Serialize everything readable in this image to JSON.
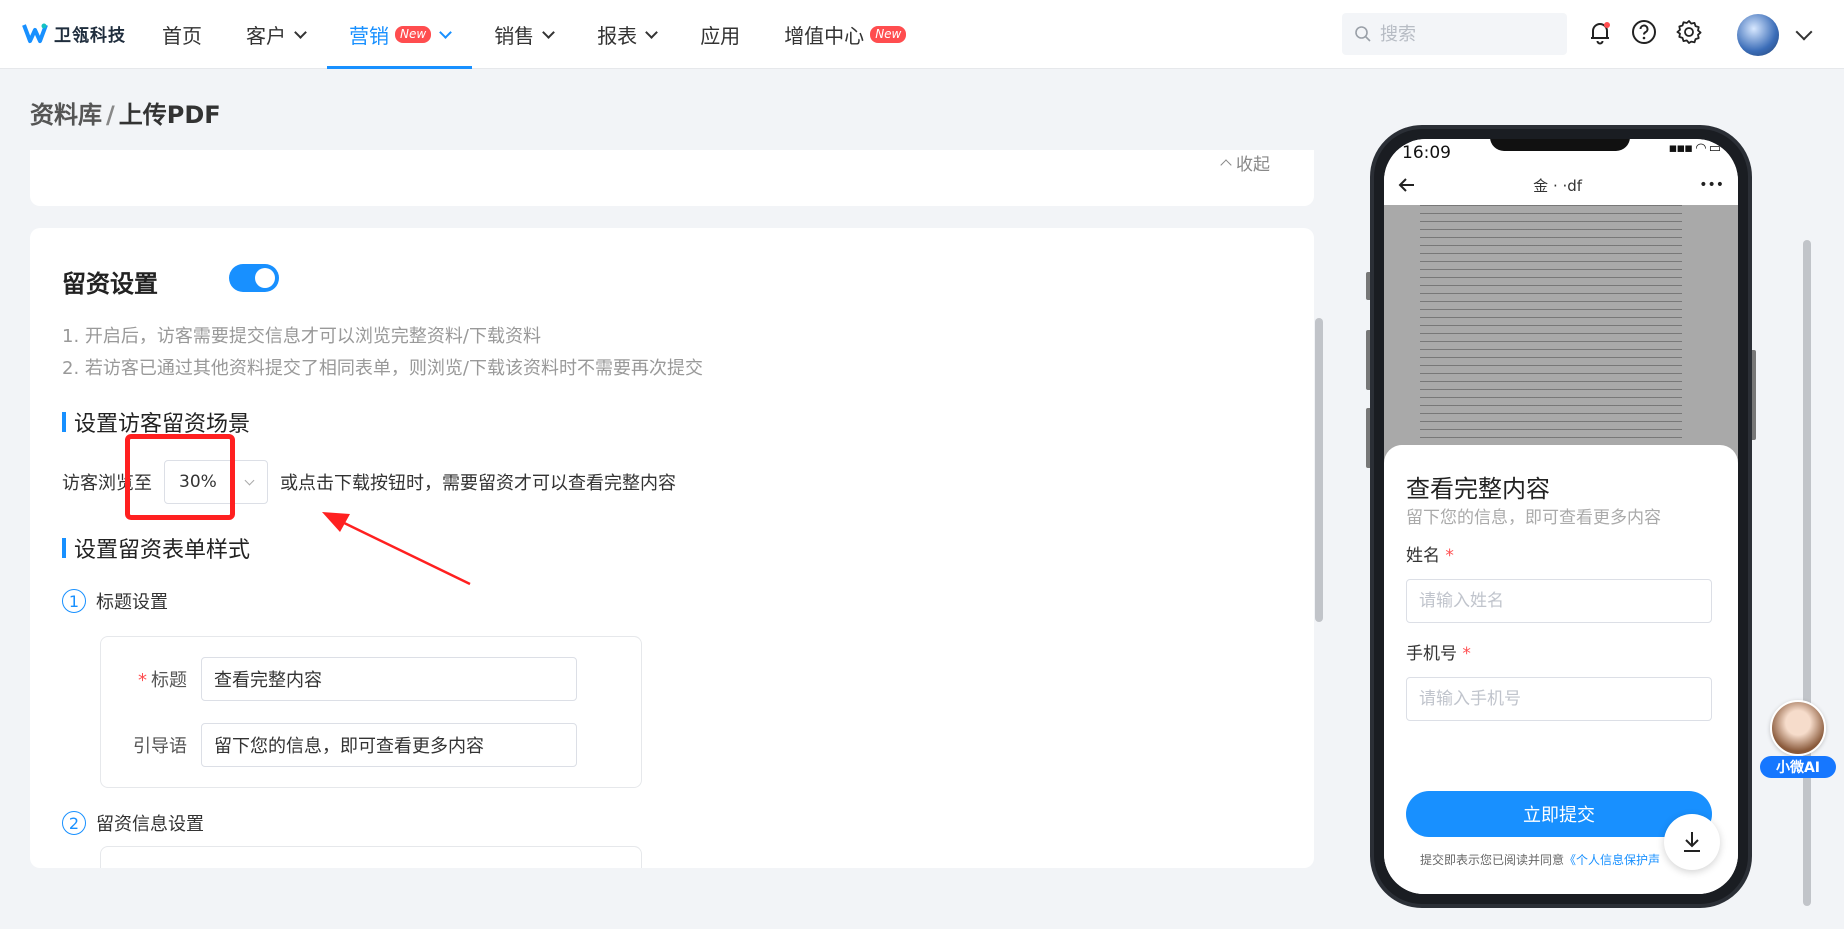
{
  "brand": {
    "name": "卫瓴科技"
  },
  "nav": {
    "items": [
      {
        "label": "首页",
        "chevron": false,
        "badge": ""
      },
      {
        "label": "客户",
        "chevron": true,
        "badge": ""
      },
      {
        "label": "营销",
        "chevron": true,
        "badge": "New",
        "active": true
      },
      {
        "label": "销售",
        "chevron": true,
        "badge": ""
      },
      {
        "label": "报表",
        "chevron": true,
        "badge": ""
      },
      {
        "label": "应用",
        "chevron": false,
        "badge": ""
      },
      {
        "label": "增值中心",
        "chevron": false,
        "badge": "New"
      }
    ]
  },
  "search": {
    "placeholder": "搜索"
  },
  "icons": {
    "bell": "bell-icon",
    "help": "help-icon",
    "settings": "gear-icon"
  },
  "breadcrumb": {
    "root": "资料库",
    "separator": "/",
    "current": "上传PDF"
  },
  "collapse_label": "收起",
  "lead_settings": {
    "title": "留资设置",
    "toggle_on": true,
    "notes": [
      "1. 开启后，访客需要提交信息才可以浏览完整资料/下载资料",
      "2. 若访客已通过其他资料提交了相同表单，则浏览/下载该资料时不需要再次提交"
    ],
    "scene_title": "设置访客留资场景",
    "scene_prefix": "访客浏览至",
    "scene_value": "30%",
    "scene_suffix": "或点击下载按钮时，需要留资才可以查看完整内容",
    "form_style_title": "设置留资表单样式",
    "step1": {
      "num": "1",
      "label": "标题设置"
    },
    "title_label": "标题",
    "title_value": "查看完整内容",
    "guide_label": "引导语",
    "guide_value": "留下您的信息，即可查看更多内容",
    "step2": {
      "num": "2",
      "label": "留资信息设置"
    }
  },
  "phone": {
    "time": "16:09",
    "status_icons": "▪▪▪ ◠ ▭",
    "title": "金        ·        ·df",
    "more": "•••",
    "sheet_title": "查看完整内容",
    "sheet_sub": "留下您的信息，即可查看更多内容",
    "name_label": "姓名",
    "name_placeholder": "请输入姓名",
    "phone_label": "手机号",
    "phone_placeholder": "请输入手机号",
    "required_mark": "*",
    "submit": "立即提交",
    "agree_text": "提交即表示您已阅读并同意",
    "agree_link": "《个人信息保护声"
  },
  "ai_assistant": {
    "label": "小微AI"
  },
  "colors": {
    "accent": "#1890ff",
    "danger": "#ff4d4f",
    "highlight": "#ff2020"
  }
}
